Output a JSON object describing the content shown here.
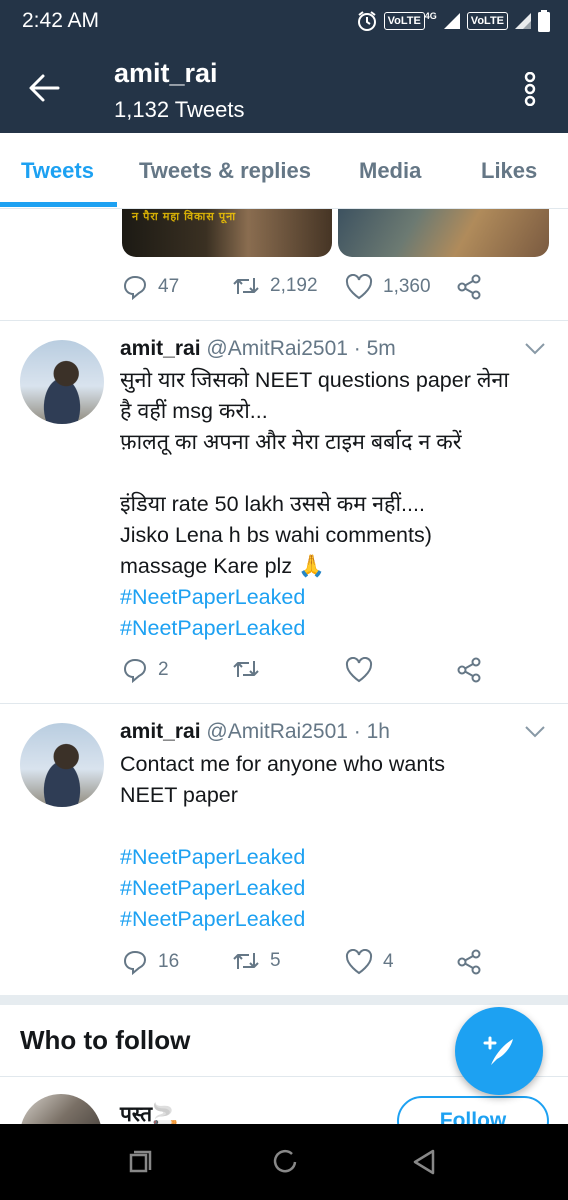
{
  "status_bar": {
    "time": "2:42 AM",
    "volte1": "VoLTE",
    "network": "4G",
    "volte2": "VoLTE"
  },
  "header": {
    "title": "amit_rai",
    "subtitle": "1,132 Tweets"
  },
  "tabs": [
    {
      "label": "Tweets",
      "active": true
    },
    {
      "label": "Tweets & replies",
      "active": false
    },
    {
      "label": "Media",
      "active": false
    },
    {
      "label": "Likes",
      "active": false
    }
  ],
  "top_tweet": {
    "image_caption": "न पैरा महा विकास पूना",
    "replies": "47",
    "retweets": "2,192",
    "likes": "1,360"
  },
  "tweets": [
    {
      "name": "amit_rai",
      "meta": "@AmitRai2501 · 5m",
      "lines": [
        "सुनो यार जिसको NEET questions paper लेना",
        "है वहीं msg करो...",
        "फ़ालतू का अपना और मेरा टाइम बर्बाद न करें",
        "",
        "इंडिया rate 50 lakh  उससे कम नहीं....",
        "Jisko Lena h bs wahi comments)",
        "massage Kare plz 🙏"
      ],
      "hashtags": [
        "#NeetPaperLeaked",
        "#NeetPaperLeaked"
      ],
      "replies": "2",
      "retweets": "",
      "likes": ""
    },
    {
      "name": "amit_rai",
      "meta": "@AmitRai2501 · 1h",
      "lines": [
        "Contact me for anyone who wants",
        "NEET paper",
        ""
      ],
      "hashtags": [
        "#NeetPaperLeaked",
        "#NeetPaperLeaked",
        "#NeetPaperLeaked"
      ],
      "replies": "16",
      "retweets": "5",
      "likes": "4"
    }
  ],
  "who_to_follow": {
    "title": "Who to follow",
    "suggestion_name": "पस्त🚬",
    "follow_label": "Follow"
  },
  "colors": {
    "header_bg": "#243447",
    "accent": "#1da1f2",
    "muted": "#657786"
  }
}
